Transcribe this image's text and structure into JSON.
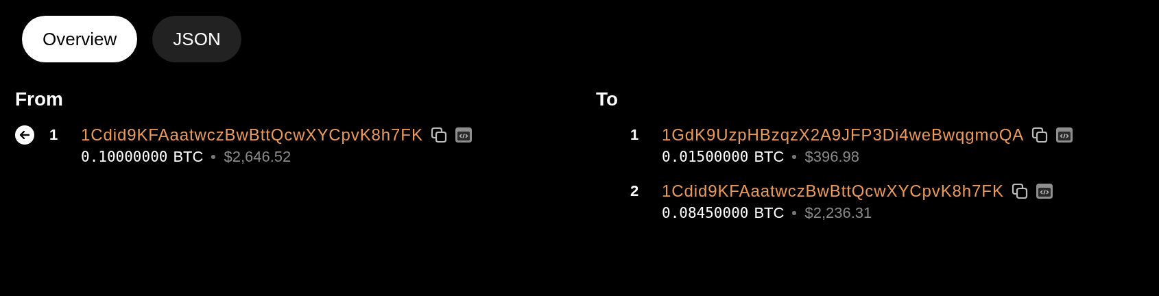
{
  "tabs": [
    {
      "label": "Overview",
      "selected": true
    },
    {
      "label": "JSON",
      "selected": false
    }
  ],
  "from": {
    "title": "From",
    "items": [
      {
        "index": "1",
        "address": "1Cdid9KFAaatwczBwBttQcwXYCpvK8h7FK",
        "amount": "0.10000000",
        "unit": "BTC",
        "fiat": "$2,646.52",
        "prev_link": true
      }
    ]
  },
  "to": {
    "title": "To",
    "items": [
      {
        "index": "1",
        "address": "1GdK9UzpHBzqzX2A9JFP3Di4weBwqgmoQA",
        "amount": "0.01500000",
        "unit": "BTC",
        "fiat": "$396.98",
        "prev_link": false
      },
      {
        "index": "2",
        "address": "1Cdid9KFAaatwczBwBttQcwXYCpvK8h7FK",
        "amount": "0.08450000",
        "unit": "BTC",
        "fiat": "$2,236.31",
        "prev_link": false
      }
    ]
  }
}
